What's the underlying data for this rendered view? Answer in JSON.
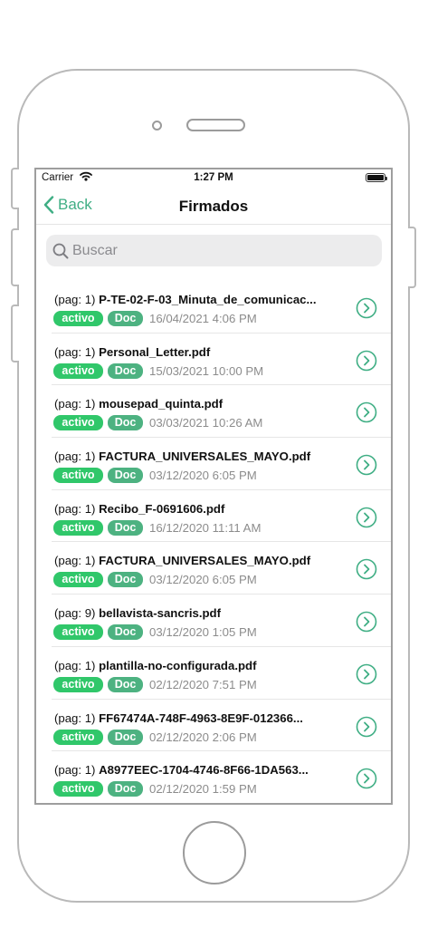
{
  "status_bar": {
    "carrier": "Carrier",
    "time": "1:27 PM"
  },
  "nav": {
    "back_label": "Back",
    "title": "Firmados"
  },
  "search": {
    "placeholder": "Buscar"
  },
  "colors": {
    "accent": "#3fae84",
    "badge_active": "#30c76a",
    "badge_doc": "#4db281"
  },
  "documents": [
    {
      "page": "(pag: 1)",
      "name": "P-TE-02-F-03_Minuta_de_comunicac...",
      "status": "activo",
      "type": "Doc",
      "date": "16/04/2021 4:06 PM"
    },
    {
      "page": "(pag: 1)",
      "name": "Personal_Letter.pdf",
      "status": "activo",
      "type": "Doc",
      "date": "15/03/2021 10:00 PM"
    },
    {
      "page": "(pag: 1)",
      "name": "mousepad_quinta.pdf",
      "status": "activo",
      "type": "Doc",
      "date": "03/03/2021 10:26 AM"
    },
    {
      "page": "(pag: 1)",
      "name": "FACTURA_UNIVERSALES_MAYO.pdf",
      "status": "activo",
      "type": "Doc",
      "date": "03/12/2020 6:05 PM"
    },
    {
      "page": "(pag: 1)",
      "name": "Recibo_F-0691606.pdf",
      "status": "activo",
      "type": "Doc",
      "date": "16/12/2020 11:11 AM"
    },
    {
      "page": "(pag: 1)",
      "name": "FACTURA_UNIVERSALES_MAYO.pdf",
      "status": "activo",
      "type": "Doc",
      "date": "03/12/2020 6:05 PM"
    },
    {
      "page": "(pag: 9)",
      "name": "bellavista-sancris.pdf",
      "status": "activo",
      "type": "Doc",
      "date": "03/12/2020 1:05 PM"
    },
    {
      "page": "(pag: 1)",
      "name": "plantilla-no-configurada.pdf",
      "status": "activo",
      "type": "Doc",
      "date": "02/12/2020 7:51 PM"
    },
    {
      "page": "(pag: 1)",
      "name": "FF67474A-748F-4963-8E9F-012366...",
      "status": "activo",
      "type": "Doc",
      "date": "02/12/2020 2:06 PM"
    },
    {
      "page": "(pag: 1)",
      "name": "A8977EEC-1704-4746-8F66-1DA563...",
      "status": "activo",
      "type": "Doc",
      "date": "02/12/2020 1:59 PM"
    }
  ]
}
